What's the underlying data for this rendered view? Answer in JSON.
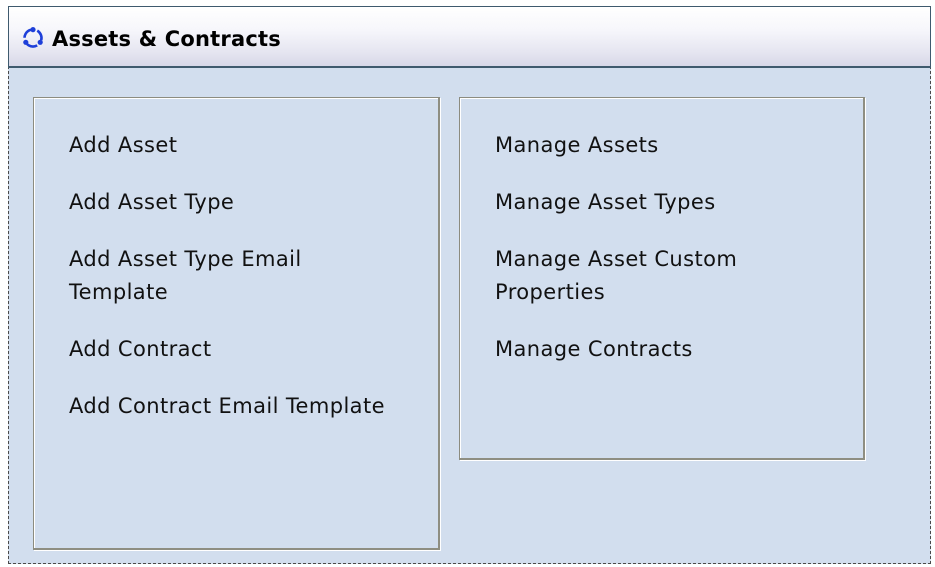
{
  "header": {
    "title": "Assets & Contracts",
    "icon": "circular-arrows-icon",
    "icon_color": "#1e3fd9"
  },
  "left_column": {
    "items": [
      {
        "label": "Add Asset"
      },
      {
        "label": "Add Asset Type"
      },
      {
        "label": "Add Asset Type Email Template"
      },
      {
        "label": "Add Contract"
      },
      {
        "label": "Add Contract Email Template"
      }
    ]
  },
  "right_column": {
    "items": [
      {
        "label": "Manage Assets"
      },
      {
        "label": "Manage Asset Types"
      },
      {
        "label": "Manage Asset Custom Properties"
      },
      {
        "label": "Manage Contracts"
      }
    ]
  },
  "colors": {
    "panel_background": "#d2deee",
    "header_border": "#3f5a6e"
  }
}
